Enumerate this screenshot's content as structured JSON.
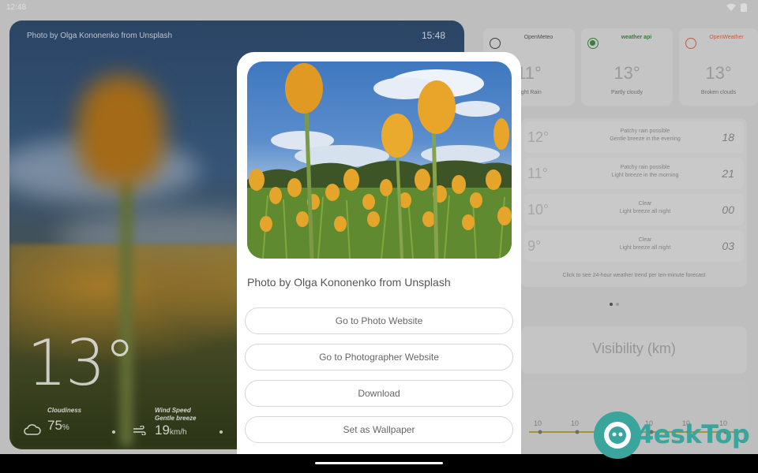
{
  "status_bar": {
    "time": "12:48"
  },
  "hero": {
    "credit": "Photo by Olga Kononenko from Unsplash",
    "time": "15:48",
    "temperature": "13°",
    "stats": [
      {
        "label": "Cloudiness",
        "value": "75",
        "unit": "%"
      },
      {
        "label": "Wind Speed\nGentle breeze",
        "value": "19",
        "unit": "km/h"
      }
    ]
  },
  "providers": [
    {
      "name": "OpenMeteo",
      "temp": "11°",
      "desc": "Light Rain",
      "selected": false
    },
    {
      "name": "weather api",
      "temp": "13°",
      "desc": "Partly cloudy",
      "selected": true
    },
    {
      "name": "OpenWeather",
      "temp": "13°",
      "desc": "Broken clouds",
      "selected": false
    }
  ],
  "forecast": {
    "rows": [
      {
        "temp": "12°",
        "desc": "Patchy rain possible\nGentle breeze in the evening",
        "value": "18"
      },
      {
        "temp": "11°",
        "desc": "Patchy rain possible\nLight breeze in the morning",
        "value": "21"
      },
      {
        "temp": "10°",
        "desc": "Clear\nLight breeze all night",
        "value": "00"
      },
      {
        "temp": "9°",
        "desc": "Clear\nLight breeze all night",
        "value": "03"
      }
    ],
    "note": "Click to see 24-hour weather trend per ten-minute forecast"
  },
  "visibility": {
    "title": "Visibility (km)"
  },
  "chart": {
    "ticks": [
      "10",
      "10",
      "10",
      "10",
      "10",
      "10"
    ]
  },
  "dialog": {
    "photo_credit": "Photo by Olga Kononenko from Unsplash",
    "actions": [
      "Go to Photo Website",
      "Go to Photographer Website",
      "Download",
      "Set as Wallpaper"
    ]
  },
  "watermark": {
    "text": "4eskTop"
  }
}
